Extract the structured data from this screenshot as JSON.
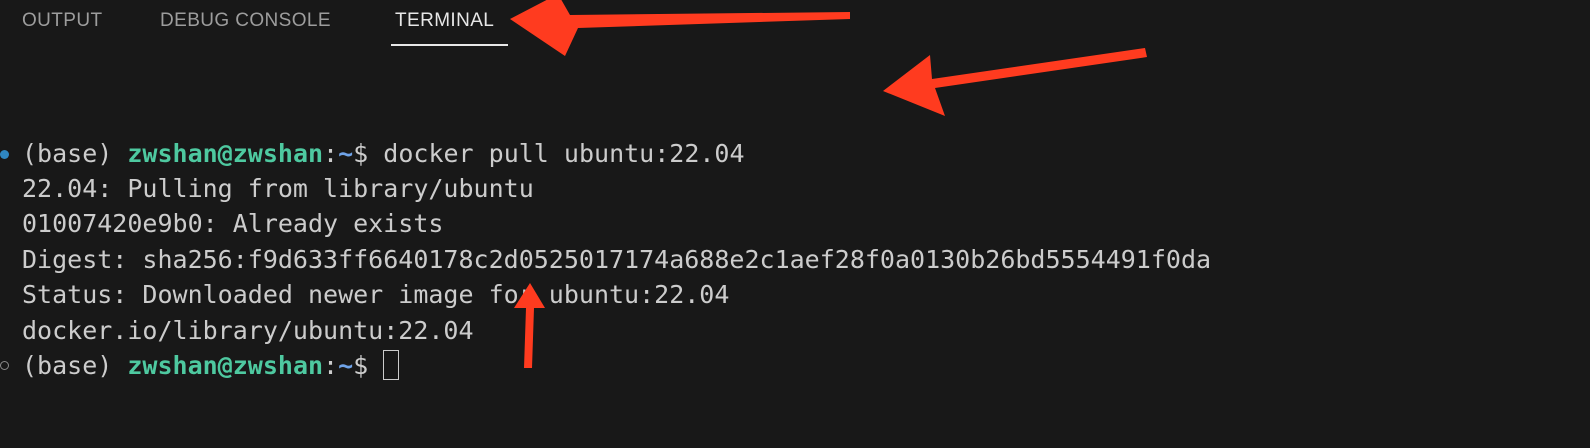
{
  "tabs": [
    {
      "label": "OUTPUT",
      "active": false
    },
    {
      "label": "DEBUG CONSOLE",
      "active": false
    },
    {
      "label": "TERMINAL",
      "active": true
    }
  ],
  "terminal": {
    "prompt_env": "(base)",
    "prompt_user": "zwshan@zwshan",
    "prompt_sep": ":",
    "prompt_cwd": "~",
    "prompt_symbol": "$",
    "command": "docker pull ubuntu:22.04",
    "output": [
      "22.04: Pulling from library/ubuntu",
      "01007420e9b0: Already exists",
      "Digest: sha256:f9d633ff6640178c2d0525017174a688e2c1aef28f0a0130b26bd5554491f0da",
      "Status: Downloaded newer image for ubuntu:22.04",
      "docker.io/library/ubuntu:22.04"
    ]
  },
  "colors": {
    "background": "#181818",
    "text": "#cccccc",
    "user": "#4ec9a0",
    "cwd": "#6fa3e8",
    "success_dot": "#2f86c0",
    "annotation_arrow": "#ff3b1f"
  },
  "annotations": [
    {
      "icon": "red-arrow",
      "target": "terminal-tab"
    },
    {
      "icon": "red-arrow",
      "target": "docker-pull-command"
    },
    {
      "icon": "red-arrow",
      "target": "pulled-image-tag"
    }
  ]
}
